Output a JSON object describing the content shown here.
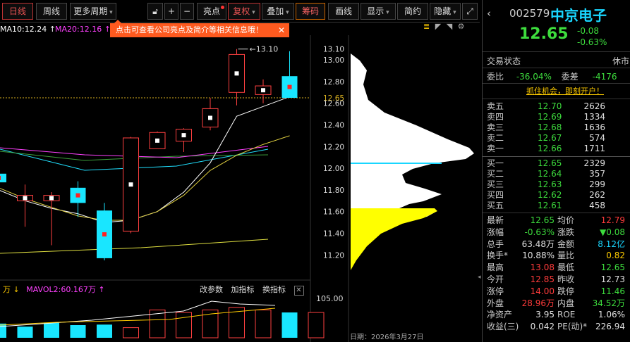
{
  "toolbar": {
    "daily": "日线",
    "weekly": "周线",
    "more_periods": "更多周期",
    "highlights": "亮点",
    "rights": "复权",
    "overlay": "叠加",
    "chips": "筹码",
    "draw": "画线",
    "display": "显示",
    "simplified": "简约",
    "hide": "隐藏"
  },
  "indicators": {
    "ma10": "MA10:12.24 ↑",
    "ma20": "MA20:12.16 ↑"
  },
  "tip": {
    "text": "点击可查看公司亮点及简介等相关信息哦！",
    "close": "✕"
  },
  "price_axis": {
    "labels": [
      "13.10",
      "13.00",
      "12.80",
      "12.65",
      "12.60",
      "12.40",
      "12.20",
      "12.00",
      "11.80",
      "11.60",
      "11.40",
      "11.20"
    ],
    "high_marker": "13.10"
  },
  "volume": {
    "vol_label": "万 ↓",
    "mavol2": "MAVOL2:60.167万 ↑",
    "axis_label": "105.00",
    "actions": [
      "改参数",
      "加指标",
      "换指标"
    ],
    "close": "✕"
  },
  "date": "日期：2026年3月27日",
  "chart_data": {
    "type": "candlestick",
    "candles": [
      {
        "open": 11.95,
        "close": 11.87,
        "high": 12.15,
        "low": 11.82
      },
      {
        "open": 11.7,
        "close": 11.75,
        "high": 11.85,
        "low": 11.46
      },
      {
        "open": 11.7,
        "close": 11.75,
        "high": 11.78,
        "low": 11.29
      },
      {
        "open": 11.82,
        "close": 11.68,
        "high": 11.88,
        "low": 11.55
      },
      {
        "open": 11.61,
        "close": 11.17,
        "high": 11.68,
        "low": 11.15
      },
      {
        "open": 11.42,
        "close": 12.28,
        "high": 12.29,
        "low": 11.4
      },
      {
        "open": 12.18,
        "close": 12.33,
        "high": 12.34,
        "low": 12.18
      },
      {
        "open": 12.25,
        "close": 12.36,
        "high": 12.37,
        "low": 12.15
      },
      {
        "open": 12.38,
        "close": 12.55,
        "high": 12.65,
        "low": 12.35
      },
      {
        "open": 12.7,
        "close": 13.05,
        "high": 13.1,
        "low": 12.58
      },
      {
        "open": 12.68,
        "close": 12.76,
        "high": 12.82,
        "low": 12.6
      },
      {
        "open": 12.85,
        "close": 12.65,
        "high": 13.08,
        "low": 12.65
      }
    ],
    "ma_lines": {
      "white": [
        11.8,
        11.7,
        11.63,
        11.58,
        11.5,
        11.52,
        11.6,
        11.78,
        12.05,
        12.48,
        12.57,
        12.66
      ],
      "yellow": [
        11.82,
        11.72,
        11.64,
        11.56,
        11.52,
        11.52,
        11.6,
        11.75,
        11.98,
        12.12,
        12.22,
        12.3
      ]
    },
    "volume": [
      28,
      22,
      30,
      25,
      26,
      20,
      55,
      50,
      55,
      60,
      55,
      50,
      50
    ],
    "last_price": 12.65,
    "ylim": [
      11.15,
      13.15
    ]
  },
  "panel": {
    "back": "‹",
    "code": "002579",
    "name": "中京电子",
    "price": "12.65",
    "change": "-0.08",
    "change_pct": "-0.63%",
    "status_label": "交易状态",
    "status_value": "休市",
    "ratio_label": "委比",
    "ratio_value": "-36.04%",
    "diff_label": "委差",
    "diff_value": "-4176",
    "promo": "抓住机会，即刻开户！",
    "asks": [
      {
        "name": "卖五",
        "price": "12.70",
        "vol": "2626"
      },
      {
        "name": "卖四",
        "price": "12.69",
        "vol": "1334"
      },
      {
        "name": "卖三",
        "price": "12.68",
        "vol": "1636"
      },
      {
        "name": "卖二",
        "price": "12.67",
        "vol": "574"
      },
      {
        "name": "卖一",
        "price": "12.66",
        "vol": "1711"
      }
    ],
    "bids": [
      {
        "name": "买一",
        "price": "12.65",
        "vol": "2329"
      },
      {
        "name": "买二",
        "price": "12.64",
        "vol": "357"
      },
      {
        "name": "买三",
        "price": "12.63",
        "vol": "299"
      },
      {
        "name": "买四",
        "price": "12.62",
        "vol": "262"
      },
      {
        "name": "买五",
        "price": "12.61",
        "vol": "458"
      }
    ],
    "stats": [
      {
        "k1": "最新",
        "v1": "12.65",
        "c1": "g",
        "k2": "均价",
        "v2": "12.79",
        "c2": "r"
      },
      {
        "k1": "涨幅",
        "v1": "-0.63%",
        "c1": "g",
        "k2": "涨跌",
        "v2": "▼0.08",
        "c2": "g"
      },
      {
        "k1": "总手",
        "v1": "63.48万",
        "c1": "w",
        "k2": "金额",
        "v2": "8.12亿",
        "c2": "c"
      },
      {
        "k1": "换手*",
        "v1": "10.88%",
        "c1": "w",
        "k2": "量比",
        "v2": "0.82",
        "c2": "y"
      },
      {
        "k1": "最高",
        "v1": "13.08",
        "c1": "r",
        "k2": "最低",
        "v2": "12.65",
        "c2": "g"
      },
      {
        "k1": "今开",
        "v1": "12.85",
        "c1": "r",
        "k2": "昨收",
        "v2": "12.73",
        "c2": "w"
      },
      {
        "k1": "涨停",
        "v1": "14.00",
        "c1": "r",
        "k2": "跌停",
        "v2": "11.46",
        "c2": "g"
      },
      {
        "k1": "外盘",
        "v1": "28.96万",
        "c1": "r",
        "k2": "内盘",
        "v2": "34.52万",
        "c2": "g"
      },
      {
        "k1": "净资产",
        "v1": "3.95",
        "c1": "w",
        "k2": "ROE",
        "v2": "1.06%",
        "c2": "w"
      },
      {
        "k1": "收益(三)",
        "v1": "0.042",
        "c1": "w",
        "k2": "PE(动)*",
        "v2": "226.94",
        "c2": "w"
      }
    ]
  }
}
